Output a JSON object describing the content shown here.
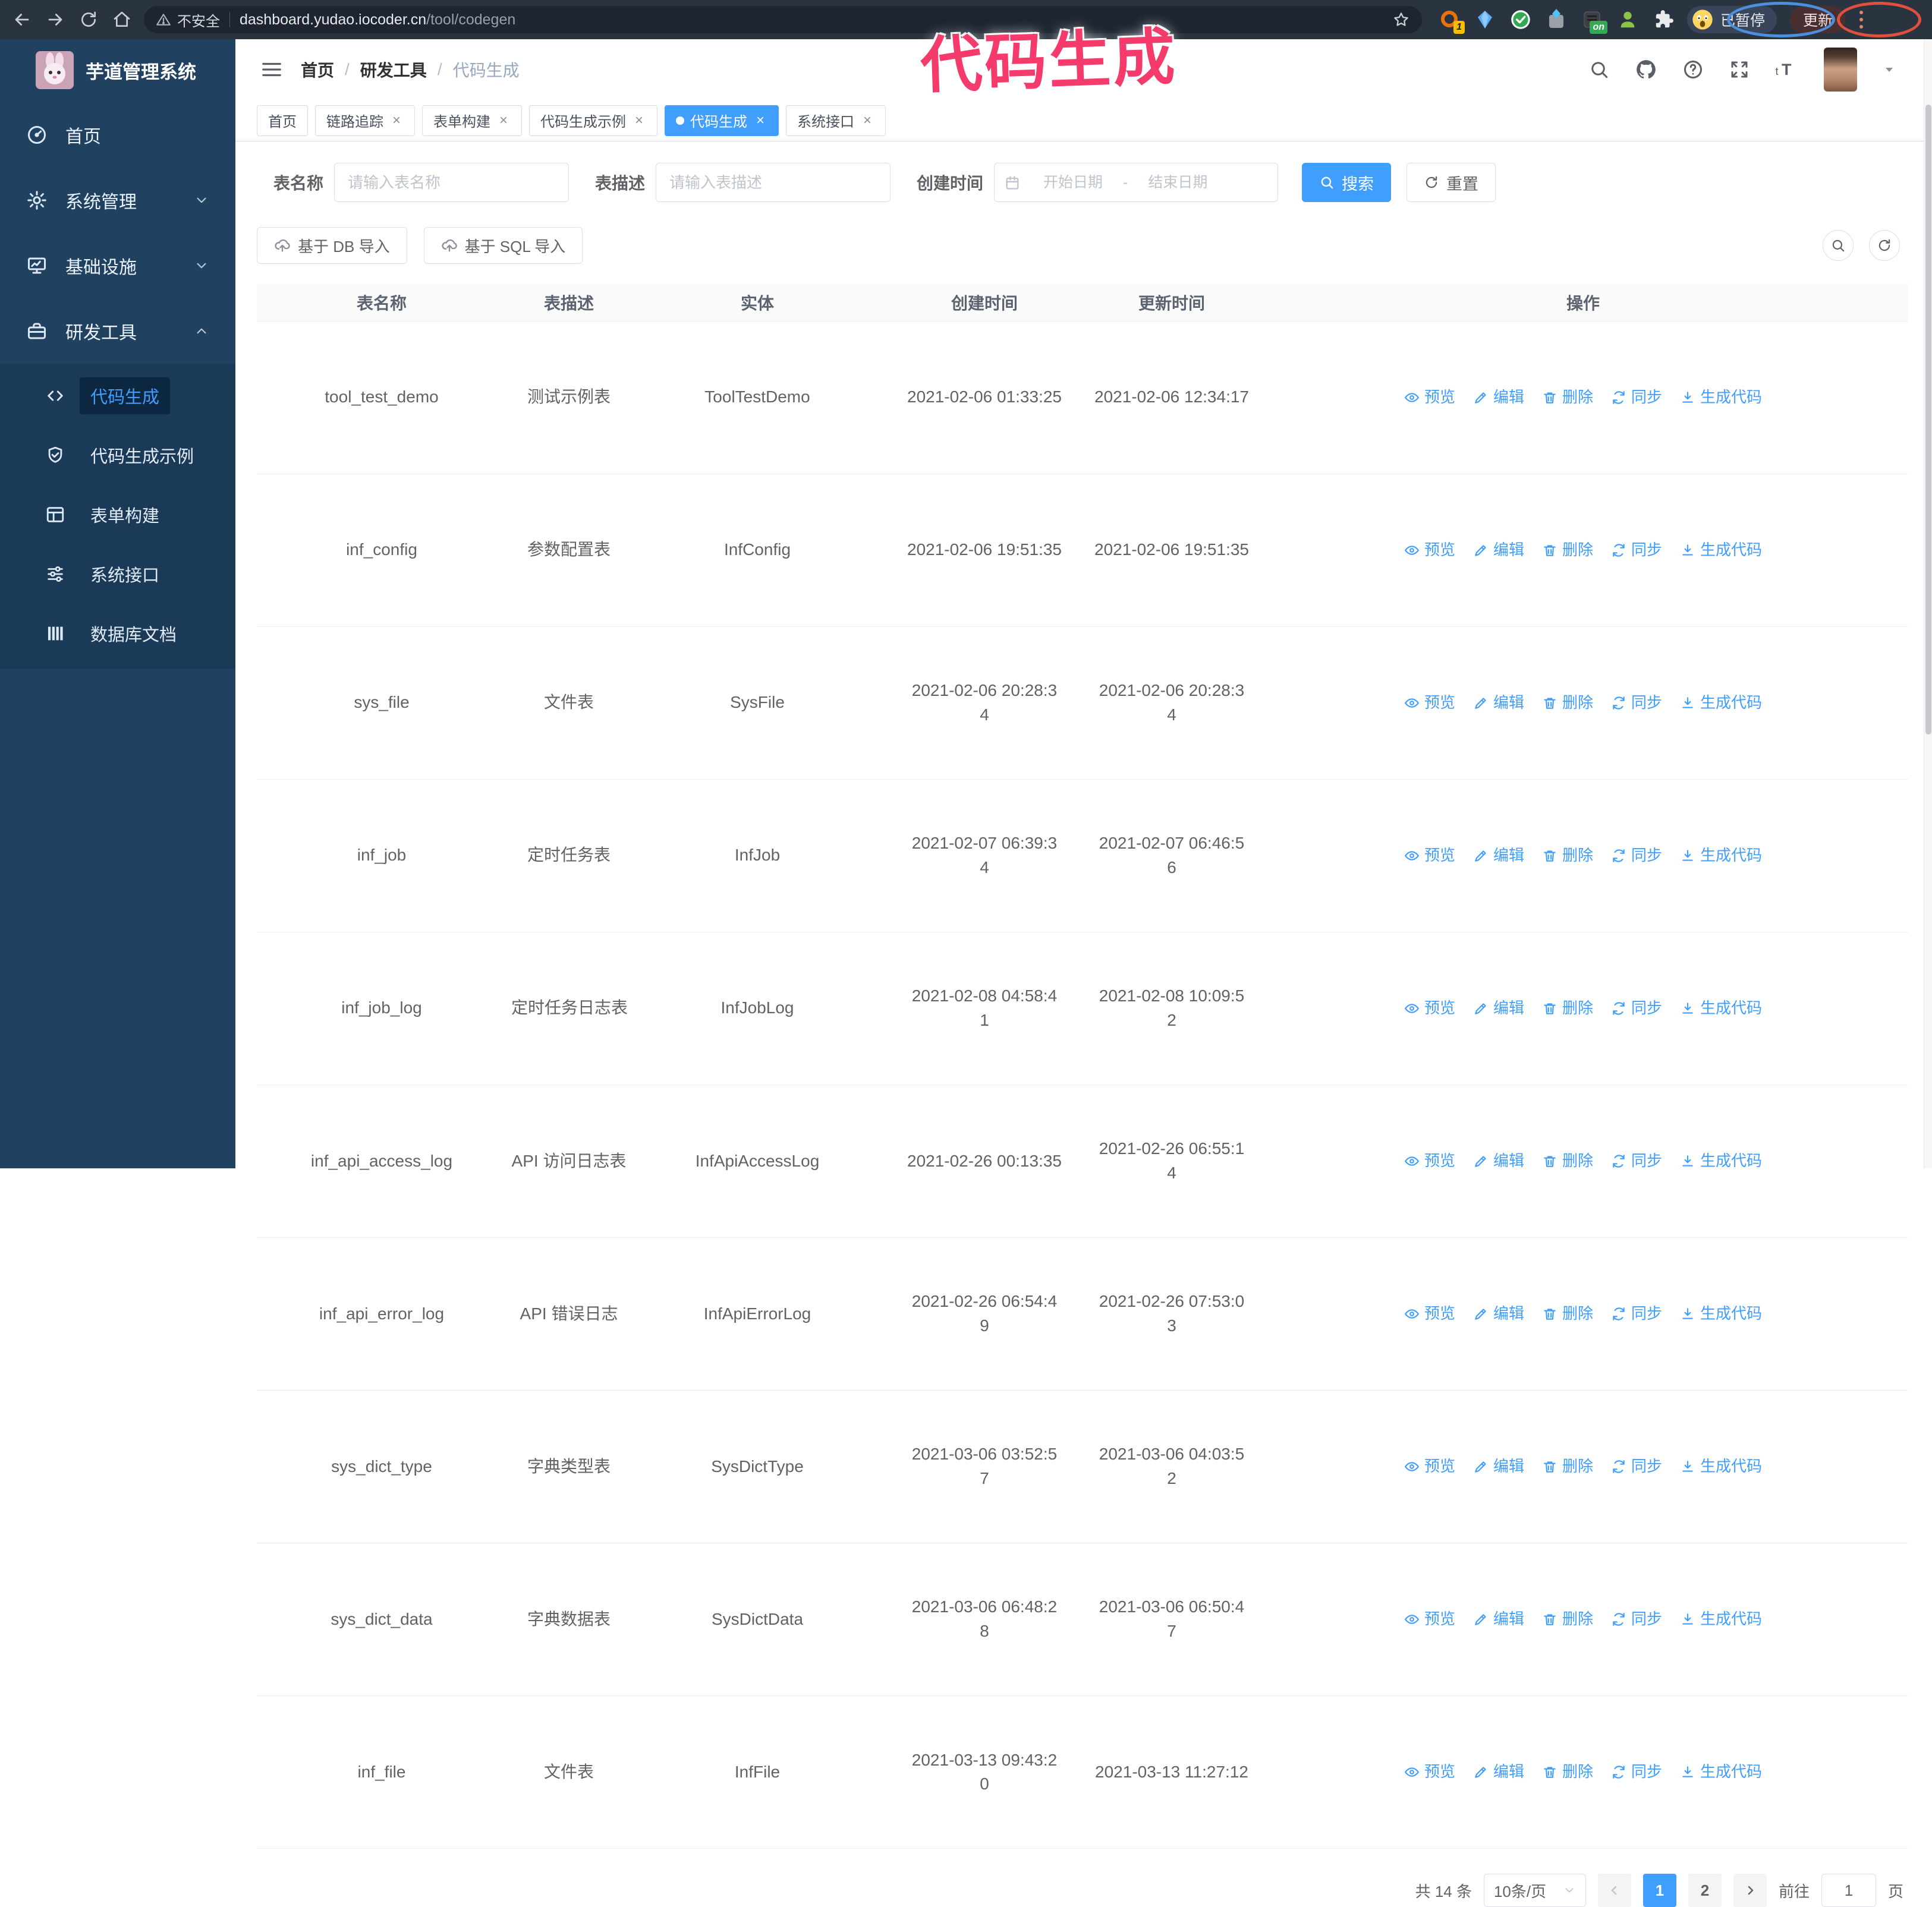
{
  "browser": {
    "security_label": "不安全",
    "url_domain": "dashboard.yudao.iocoder.cn",
    "url_path": "/tool/codegen",
    "ext_badge_count": "1",
    "ext_badge_on": "on",
    "profile_label": "已暂停",
    "update_label": "更新"
  },
  "annotation": {
    "title": "代码生成"
  },
  "sidebar": {
    "app_title": "芋道管理系统",
    "menu": [
      {
        "label": "首页"
      },
      {
        "label": "系统管理"
      },
      {
        "label": "基础设施"
      },
      {
        "label": "研发工具"
      }
    ],
    "submenu": [
      {
        "label": "代码生成"
      },
      {
        "label": "代码生成示例"
      },
      {
        "label": "表单构建"
      },
      {
        "label": "系统接口"
      },
      {
        "label": "数据库文档"
      }
    ]
  },
  "navbar": {
    "breadcrumb": [
      "首页",
      "研发工具",
      "代码生成"
    ]
  },
  "tabs": [
    {
      "label": "首页"
    },
    {
      "label": "链路追踪"
    },
    {
      "label": "表单构建"
    },
    {
      "label": "代码生成示例"
    },
    {
      "label": "代码生成"
    },
    {
      "label": "系统接口"
    }
  ],
  "filters": {
    "name_label": "表名称",
    "name_placeholder": "请输入表名称",
    "desc_label": "表描述",
    "desc_placeholder": "请输入表描述",
    "time_label": "创建时间",
    "start_placeholder": "开始日期",
    "range_separator": "-",
    "end_placeholder": "结束日期",
    "search_label": "搜索",
    "reset_label": "重置"
  },
  "toolbar": {
    "import_db_label": "基于 DB 导入",
    "import_sql_label": "基于 SQL 导入"
  },
  "table": {
    "headers": [
      "表名称",
      "表描述",
      "实体",
      "创建时间",
      "更新时间",
      "操作"
    ],
    "actions": {
      "preview": "预览",
      "edit": "编辑",
      "delete": "删除",
      "sync": "同步",
      "generate": "生成代码"
    },
    "rows": [
      {
        "name": "tool_test_demo",
        "desc": "测试示例表",
        "entity": "ToolTestDemo",
        "created": "2021-02-06 01:33:25",
        "updated": "2021-02-06 12:34:17"
      },
      {
        "name": "inf_config",
        "desc": "参数配置表",
        "entity": "InfConfig",
        "created": "2021-02-06 19:51:35",
        "updated": "2021-02-06 19:51:35"
      },
      {
        "name": "sys_file",
        "desc": "文件表",
        "entity": "SysFile",
        "created": "2021-02-06 20:28:3\n4",
        "updated": "2021-02-06 20:28:3\n4"
      },
      {
        "name": "inf_job",
        "desc": "定时任务表",
        "entity": "InfJob",
        "created": "2021-02-07 06:39:3\n4",
        "updated": "2021-02-07 06:46:5\n6"
      },
      {
        "name": "inf_job_log",
        "desc": "定时任务日志表",
        "entity": "InfJobLog",
        "created": "2021-02-08 04:58:4\n1",
        "updated": "2021-02-08 10:09:5\n2"
      },
      {
        "name": "inf_api_access_log",
        "desc": "API 访问日志表",
        "entity": "InfApiAccessLog",
        "created": "2021-02-26 00:13:35",
        "updated": "2021-02-26 06:55:1\n4"
      },
      {
        "name": "inf_api_error_log",
        "desc": "API 错误日志",
        "entity": "InfApiErrorLog",
        "created": "2021-02-26 06:54:4\n9",
        "updated": "2021-02-26 07:53:0\n3"
      },
      {
        "name": "sys_dict_type",
        "desc": "字典类型表",
        "entity": "SysDictType",
        "created": "2021-03-06 03:52:5\n7",
        "updated": "2021-03-06 04:03:5\n2"
      },
      {
        "name": "sys_dict_data",
        "desc": "字典数据表",
        "entity": "SysDictData",
        "created": "2021-03-06 06:48:2\n8",
        "updated": "2021-03-06 06:50:4\n7"
      },
      {
        "name": "inf_file",
        "desc": "文件表",
        "entity": "InfFile",
        "created": "2021-03-13 09:43:2\n0",
        "updated": "2021-03-13 11:27:12"
      }
    ]
  },
  "pagination": {
    "total": "共 14 条",
    "page_size": "10条/页",
    "pages": [
      "1",
      "2"
    ],
    "goto_label": "前往",
    "goto_value": "1",
    "page_unit": "页"
  },
  "colors": {
    "accent": "#409eff",
    "sidebar_bg": "#204160",
    "annotation_pink": "#f43b6c",
    "annotation_blue": "#4b8fdd",
    "annotation_red": "#e0503e"
  }
}
